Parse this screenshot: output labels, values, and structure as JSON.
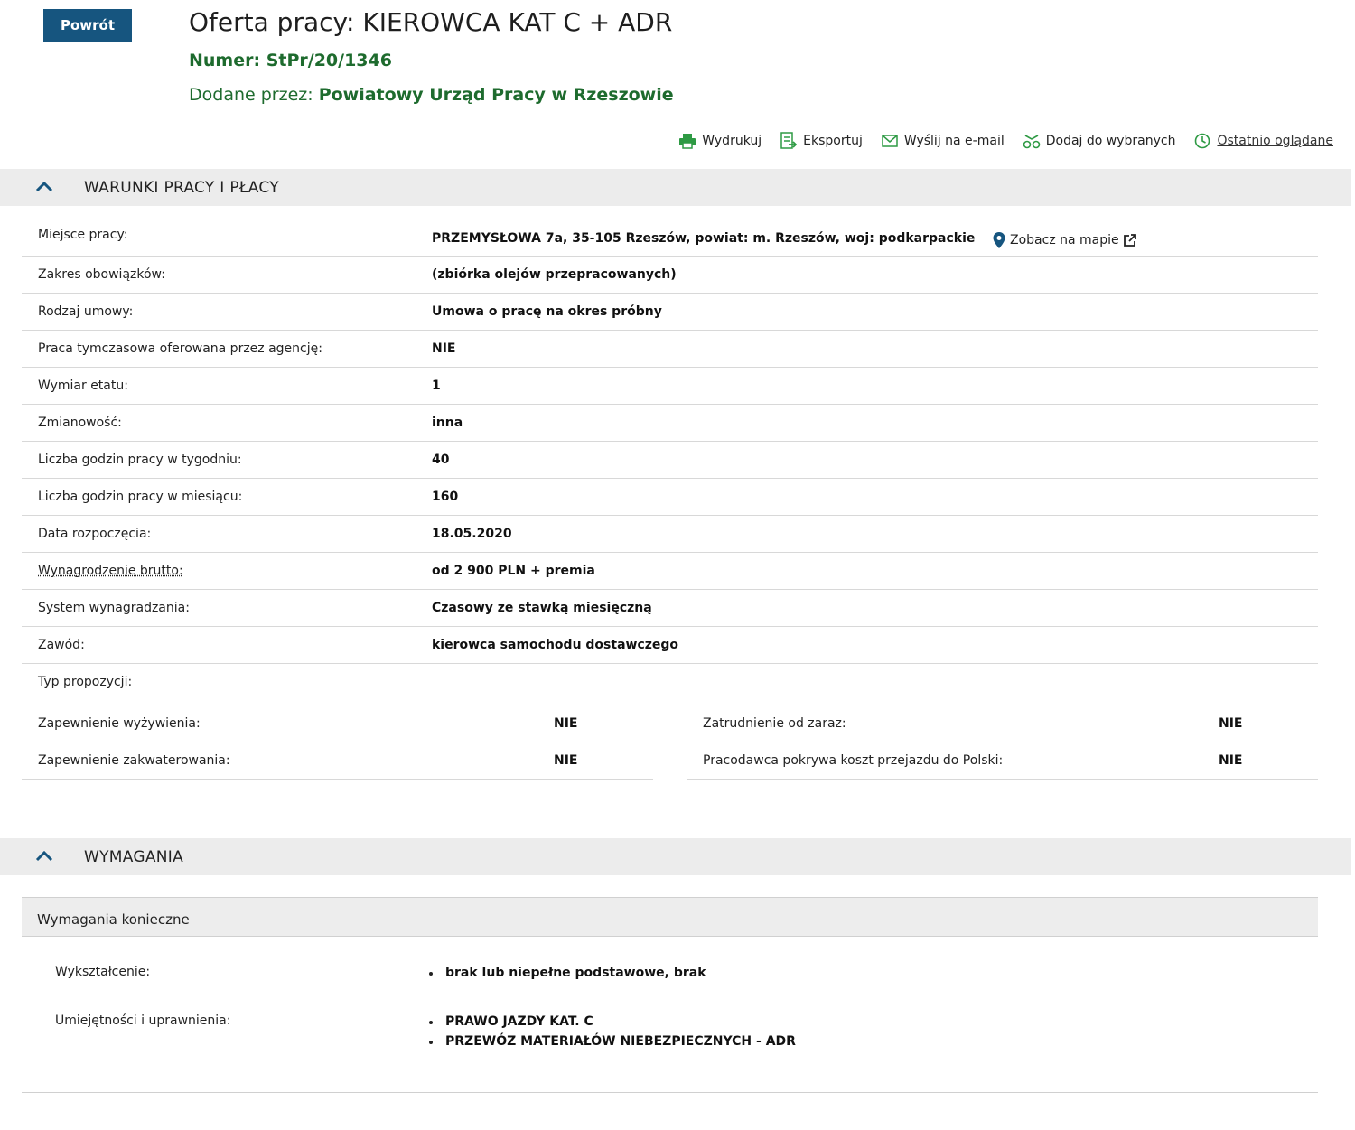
{
  "header": {
    "back_label": "Powrót",
    "title": "Oferta pracy: KIEROWCA KAT C + ADR",
    "number": "Numer: StPr/20/1346",
    "added_by_label": "Dodane przez:",
    "added_by_value": "Powiatowy Urząd Pracy w Rzeszowie"
  },
  "toolbar": {
    "print": "Wydrukuj",
    "export": "Eksportuj",
    "email": "Wyślij na e-mail",
    "favorite": "Dodaj do wybranych",
    "recent": "Ostatnio oglądane"
  },
  "sections": {
    "conditions_title": "WARUNKI PRACY I PŁACY",
    "requirements_title": "WYMAGANIA"
  },
  "conditions": {
    "rows": [
      {
        "label": "Miejsce pracy:",
        "value": "PRZEMYSŁOWA 7a, 35-105 Rzeszów, powiat: m. Rzeszów, woj: podkarpackie"
      },
      {
        "label": "Zakres obowiązków:",
        "value": "(zbiórka olejów przepracowanych)"
      },
      {
        "label": "Rodzaj umowy:",
        "value": "Umowa o pracę na okres próbny"
      },
      {
        "label": "Praca tymczasowa oferowana przez agencję:",
        "value": "NIE"
      },
      {
        "label": "Wymiar etatu:",
        "value": "1"
      },
      {
        "label": "Zmianowość:",
        "value": "inna"
      },
      {
        "label": "Liczba godzin pracy w tygodniu:",
        "value": "40"
      },
      {
        "label": "Liczba godzin pracy w miesiącu:",
        "value": "160"
      },
      {
        "label": "Data rozpoczęcia:",
        "value": "18.05.2020"
      },
      {
        "label": "Wynagrodzenie brutto:",
        "value": "od 2 900 PLN + premia"
      },
      {
        "label": "System wynagradzania:",
        "value": "Czasowy ze stawką miesięczną"
      },
      {
        "label": "Zawód:",
        "value": "kierowca samochodu dostawczego"
      },
      {
        "label": "Typ propozycji:",
        "value": ""
      }
    ],
    "map_link": "Zobacz na mapie",
    "proposal": [
      {
        "label": "Zapewnienie wyżywienia:",
        "value": "NIE"
      },
      {
        "label": "Zatrudnienie od zaraz:",
        "value": "NIE"
      },
      {
        "label": "Zapewnienie zakwaterowania:",
        "value": "NIE"
      },
      {
        "label": "Pracodawca pokrywa koszt przejazdu do Polski:",
        "value": "NIE"
      }
    ]
  },
  "requirements": {
    "subheader": "Wymagania konieczne",
    "education_label": "Wykształcenie:",
    "education_items": [
      "brak lub niepełne podstawowe, brak"
    ],
    "skills_label": "Umiejętności i uprawnienia:",
    "skills_items": [
      "PRAWO JAZDY KAT. C",
      "PRZEWÓZ MATERIAŁÓW NIEBEZPIECZNYCH - ADR"
    ]
  }
}
